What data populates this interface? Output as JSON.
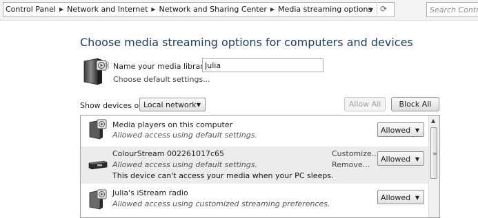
{
  "address_bar": {
    "crumbs": [
      "Control Panel",
      "Network and Internet",
      "Network and Sharing Center",
      "Media streaming options"
    ],
    "search_placeholder": "Search Control Panel"
  },
  "main": {
    "title": "Choose media streaming options for computers and devices",
    "library_label": "Name your media library:",
    "library_name": "Julia",
    "default_settings_link": "Choose default settings...",
    "show_devices_label": "Show devices on:",
    "show_devices_value": "Local network",
    "allow_all": "Allow All",
    "block_all": "Block All"
  },
  "devices": [
    {
      "name": "Media players on this computer",
      "status": "Allowed access using default settings.",
      "permission": "Allowed",
      "icon": "media-player-icon"
    },
    {
      "name": "ColourStream 002261017c65",
      "status": "Allowed access using default settings.",
      "warning": "This device can't access your media when your PC sleeps.",
      "customize": "Customize...",
      "remove": "Remove...",
      "permission": "Allowed",
      "icon": "media-device-icon"
    },
    {
      "name": "Julia's iStream radio",
      "status": "Allowed access using customized streaming preferences.",
      "permission": "Allowed",
      "icon": "radio-icon"
    }
  ]
}
